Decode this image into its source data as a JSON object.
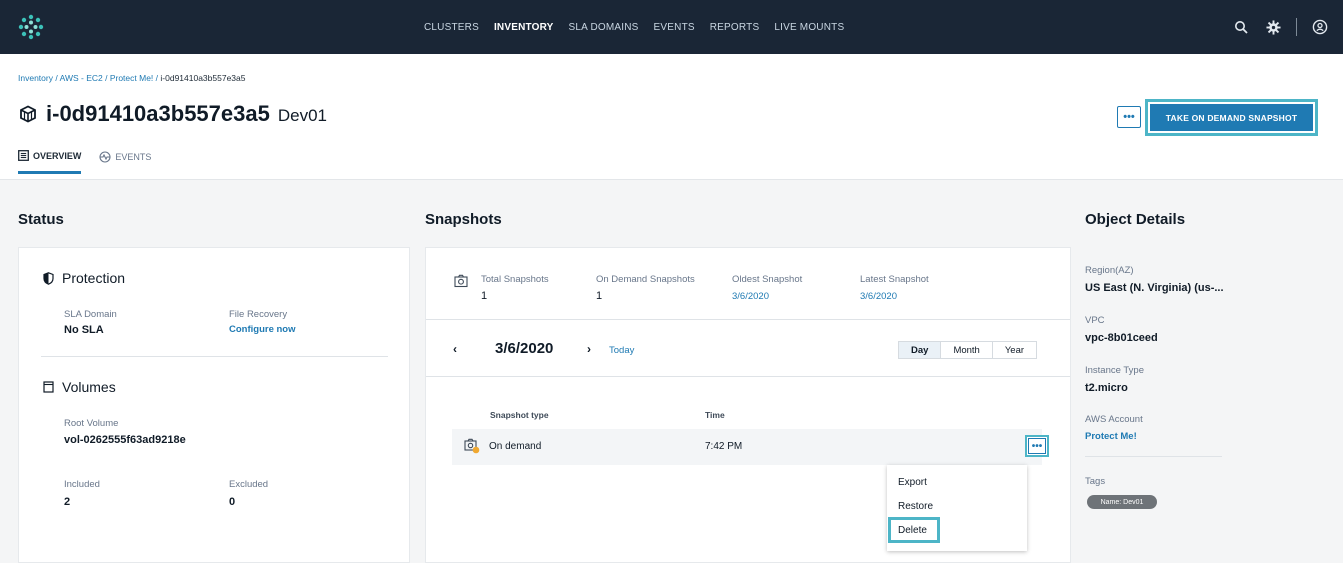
{
  "nav": {
    "items": [
      "CLUSTERS",
      "INVENTORY",
      "SLA DOMAINS",
      "EVENTS",
      "REPORTS",
      "LIVE MOUNTS"
    ],
    "active_index": 1
  },
  "top_icons": [
    "search-icon",
    "gear-icon",
    "user-icon"
  ],
  "breadcrumb": {
    "links": [
      "Inventory",
      "AWS - EC2",
      "Protect Me!"
    ],
    "current": "i-0d91410a3b557e3a5",
    "separator": " / "
  },
  "header": {
    "title": "i-0d91410a3b557e3a5",
    "subtitle": "Dev01",
    "more_label": "•••",
    "snapshot_button": "TAKE ON DEMAND SNAPSHOT"
  },
  "tabs": [
    {
      "label": "OVERVIEW",
      "icon": "list-icon"
    },
    {
      "label": "EVENTS",
      "icon": "activity-icon"
    }
  ],
  "status": {
    "section_title": "Status",
    "protection": {
      "heading": "Protection",
      "sla_label": "SLA Domain",
      "sla_value": "No SLA",
      "file_recovery_label": "File Recovery",
      "file_recovery_link": "Configure now"
    },
    "volumes": {
      "heading": "Volumes",
      "root_label": "Root Volume",
      "root_value": "vol-0262555f63ad9218e",
      "included_label": "Included",
      "included_value": "2",
      "excluded_label": "Excluded",
      "excluded_value": "0"
    }
  },
  "snapshots": {
    "section_title": "Snapshots",
    "summary": {
      "total_label": "Total Snapshots",
      "total_value": "1",
      "ondemand_label": "On Demand Snapshots",
      "ondemand_value": "1",
      "oldest_label": "Oldest Snapshot",
      "oldest_value": "3/6/2020",
      "latest_label": "Latest Snapshot",
      "latest_value": "3/6/2020"
    },
    "date_nav": {
      "prev": "‹",
      "date": "3/6/2020",
      "next": "›",
      "today": "Today",
      "ranges": [
        "Day",
        "Month",
        "Year"
      ],
      "active_range": "Day"
    },
    "table": {
      "col_type": "Snapshot type",
      "col_time": "Time",
      "rows": [
        {
          "type": "On demand",
          "time": "7:42 PM"
        }
      ],
      "row_more": "•••"
    },
    "menu": [
      "Export",
      "Restore",
      "Delete"
    ]
  },
  "object_details": {
    "section_title": "Object Details",
    "region_label": "Region(AZ)",
    "region_value": "US East (N. Virginia) (us-...",
    "vpc_label": "VPC",
    "vpc_value": "vpc-8b01ceed",
    "instance_label": "Instance Type",
    "instance_value": "t2.micro",
    "account_label": "AWS Account",
    "account_value": "Protect Me!",
    "tags_label": "Tags",
    "tag_value": "Name: Dev01"
  },
  "colors": {
    "topbar": "#1a2636",
    "accent": "#1f7ab3",
    "highlight": "#4db5c7"
  }
}
